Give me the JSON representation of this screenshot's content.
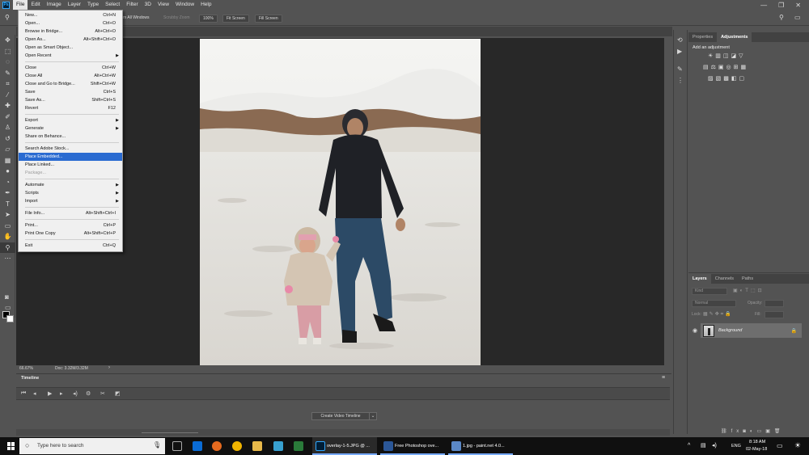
{
  "menubar": {
    "app_icon": "Ps",
    "items": [
      "File",
      "Edit",
      "Image",
      "Layer",
      "Type",
      "Select",
      "Filter",
      "3D",
      "View",
      "Window",
      "Help"
    ],
    "window_controls": [
      "—",
      "❐",
      "✕"
    ]
  },
  "options_bar": {
    "scroll_all_windows": "m All Windows",
    "scrubby_zoom": "Scrubby Zoom",
    "zoom_value": "100%",
    "fit_screen": "Fit Screen",
    "fill_screen": "Fill Screen"
  },
  "file_menu": {
    "items": [
      {
        "label": "New...",
        "shortcut": "Ctrl+N"
      },
      {
        "label": "Open...",
        "shortcut": "Ctrl+O"
      },
      {
        "label": "Browse in Bridge...",
        "shortcut": "Alt+Ctrl+O"
      },
      {
        "label": "Open As...",
        "shortcut": "Alt+Shift+Ctrl+O"
      },
      {
        "label": "Open as Smart Object...",
        "shortcut": ""
      },
      {
        "label": "Open Recent",
        "shortcut": "",
        "submenu": true
      },
      {
        "sep": true
      },
      {
        "label": "Close",
        "shortcut": "Ctrl+W"
      },
      {
        "label": "Close All",
        "shortcut": "Alt+Ctrl+W"
      },
      {
        "label": "Close and Go to Bridge...",
        "shortcut": "Shift+Ctrl+W"
      },
      {
        "label": "Save",
        "shortcut": "Ctrl+S"
      },
      {
        "label": "Save As...",
        "shortcut": "Shift+Ctrl+S"
      },
      {
        "label": "Revert",
        "shortcut": "F12"
      },
      {
        "sep": true
      },
      {
        "label": "Export",
        "shortcut": "",
        "submenu": true
      },
      {
        "label": "Generate",
        "shortcut": "",
        "submenu": true
      },
      {
        "label": "Share on Behance...",
        "shortcut": ""
      },
      {
        "sep": true
      },
      {
        "label": "Search Adobe Stock...",
        "shortcut": ""
      },
      {
        "label": "Place Embedded...",
        "shortcut": "",
        "highlighted": true
      },
      {
        "label": "Place Linked...",
        "shortcut": ""
      },
      {
        "label": "Package...",
        "shortcut": "",
        "disabled": true
      },
      {
        "sep": true
      },
      {
        "label": "Automate",
        "shortcut": "",
        "submenu": true
      },
      {
        "label": "Scripts",
        "shortcut": "",
        "submenu": true
      },
      {
        "label": "Import",
        "shortcut": "",
        "submenu": true
      },
      {
        "sep": true
      },
      {
        "label": "File Info...",
        "shortcut": "Alt+Shift+Ctrl+I"
      },
      {
        "sep": true
      },
      {
        "label": "Print...",
        "shortcut": "Ctrl+P"
      },
      {
        "label": "Print One Copy",
        "shortcut": "Alt+Shift+Ctrl+P"
      },
      {
        "sep": true
      },
      {
        "label": "Exit",
        "shortcut": "Ctrl+Q"
      }
    ]
  },
  "status": {
    "zoom": "66.67%",
    "doc": "Doc: 3.32M/3.32M"
  },
  "timeline": {
    "tab": "Timeline",
    "create_button": "Create Video Timeline"
  },
  "adjustments_panel": {
    "tabs": [
      "Properties",
      "Adjustments"
    ],
    "active_tab": "Adjustments",
    "heading": "Add an adjustment"
  },
  "layers_panel": {
    "tabs": [
      "Layers",
      "Channels",
      "Paths"
    ],
    "active_tab": "Layers",
    "kind": "Kind",
    "blend_mode": "Normal",
    "opacity_label": "Opacity:",
    "lock_label": "Lock:",
    "fill_label": "Fill:",
    "layer_name": "Background"
  },
  "taskbar": {
    "search_placeholder": "Type here to search",
    "apps": [
      {
        "label": "overlay-1-5.JPG @ ..."
      },
      {
        "label": "Free Photoshop ove..."
      },
      {
        "label": "1.jpg - paint.net 4.0..."
      }
    ],
    "language": "ENG",
    "time": "8:18 AM",
    "date": "02-May-18"
  },
  "colors": {
    "panel_bg": "#535353",
    "canvas_bg": "#282828",
    "menu_highlight": "#2a6bd1",
    "taskbar_bg": "#101010"
  }
}
